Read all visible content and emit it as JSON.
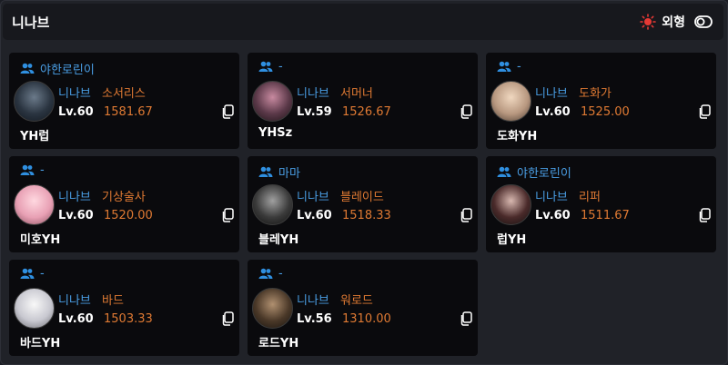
{
  "header": {
    "title": "니나브",
    "toggle_label": "외형",
    "accent_color": "#e53935"
  },
  "cards": [
    {
      "guild": "야한로린이",
      "server": "니나브",
      "class": "소서리스",
      "level": "Lv.60",
      "item_level": "1581.67",
      "name": "YH럽",
      "avatar": "sorceress-portrait"
    },
    {
      "guild": "-",
      "server": "니나브",
      "class": "서머너",
      "level": "Lv.59",
      "item_level": "1526.67",
      "name": "YHSz",
      "avatar": "summoner-portrait"
    },
    {
      "guild": "-",
      "server": "니나브",
      "class": "도화가",
      "level": "Lv.60",
      "item_level": "1525.00",
      "name": "도화YH",
      "avatar": "artist-portrait"
    },
    {
      "guild": "-",
      "server": "니나브",
      "class": "기상술사",
      "level": "Lv.60",
      "item_level": "1520.00",
      "name": "미호YH",
      "avatar": "aeromancer-portrait"
    },
    {
      "guild": "마마",
      "server": "니나브",
      "class": "블레이드",
      "level": "Lv.60",
      "item_level": "1518.33",
      "name": "블레YH",
      "avatar": "deathblade-portrait"
    },
    {
      "guild": "야한로린이",
      "server": "니나브",
      "class": "리퍼",
      "level": "Lv.60",
      "item_level": "1511.67",
      "name": "럽YH",
      "avatar": "reaper-portrait"
    },
    {
      "guild": "-",
      "server": "니나브",
      "class": "바드",
      "level": "Lv.60",
      "item_level": "1503.33",
      "name": "바드YH",
      "avatar": "bard-portrait"
    },
    {
      "guild": "-",
      "server": "니나브",
      "class": "워로드",
      "level": "Lv.56",
      "item_level": "1310.00",
      "name": "로드YH",
      "avatar": "warlord-portrait"
    }
  ]
}
